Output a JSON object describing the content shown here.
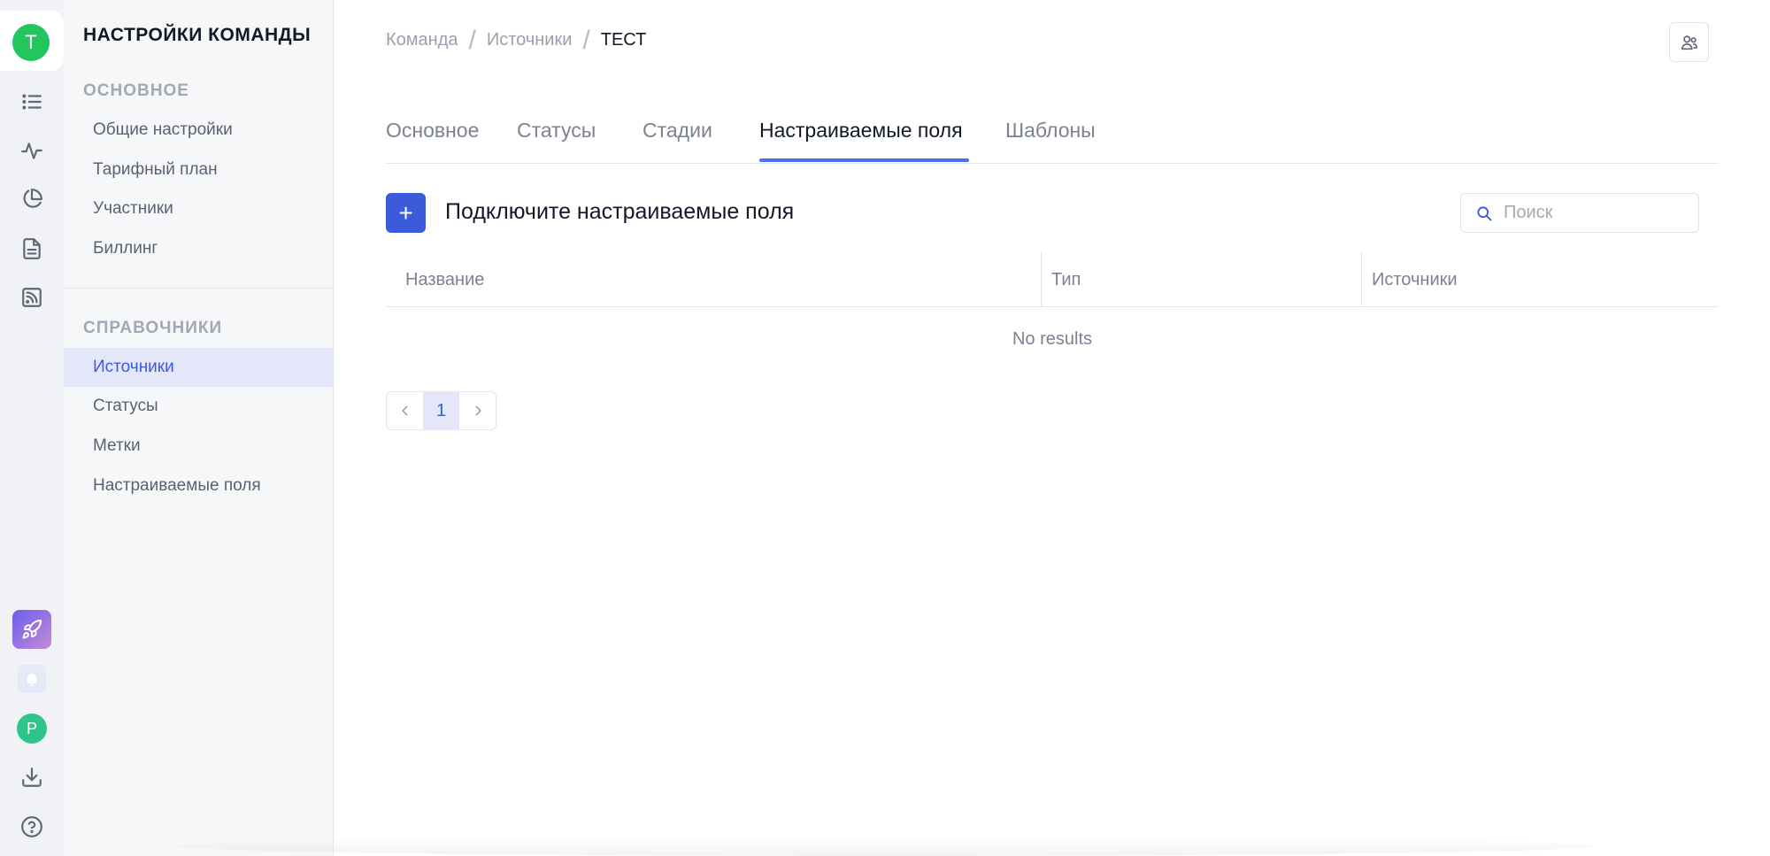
{
  "rail": {
    "team_avatar": "T",
    "user_avatar": "P",
    "icons": [
      "list-icon",
      "activity-icon",
      "pie-chart-icon",
      "document-icon",
      "rss-icon",
      "rocket-icon",
      "bell-icon",
      "download-icon",
      "help-icon"
    ]
  },
  "sidebar": {
    "title": "НАСТРОЙКИ КОМАНДЫ",
    "sections": [
      {
        "title": "ОСНОВНОЕ",
        "items": [
          {
            "label": "Общие настройки"
          },
          {
            "label": "Тарифный план"
          },
          {
            "label": "Участники"
          },
          {
            "label": "Биллинг"
          }
        ]
      },
      {
        "title": "СПРАВОЧНИКИ",
        "items": [
          {
            "label": "Источники",
            "active": true
          },
          {
            "label": "Статусы"
          },
          {
            "label": "Метки"
          },
          {
            "label": "Настраиваемые поля"
          }
        ]
      }
    ]
  },
  "breadcrumb": [
    "Команда",
    "Источники",
    "ТЕСТ"
  ],
  "tabs": [
    {
      "label": "Основное"
    },
    {
      "label": "Статусы"
    },
    {
      "label": "Стадии"
    },
    {
      "label": "Настраиваемые поля",
      "active": true
    },
    {
      "label": "Шаблоны"
    }
  ],
  "content": {
    "add_button": "+",
    "heading": "Подключите настраиваемые поля",
    "search_placeholder": "Поиск",
    "table": {
      "columns": [
        "Название",
        "Тип",
        "Источники"
      ],
      "empty_text": "No results"
    },
    "pagination": {
      "current_page": "1"
    }
  },
  "colors": {
    "accent": "#3b5bdb",
    "team_avatar": "#22c55e",
    "user_avatar": "#2fc58a",
    "active_bg": "#e3e7f9"
  }
}
